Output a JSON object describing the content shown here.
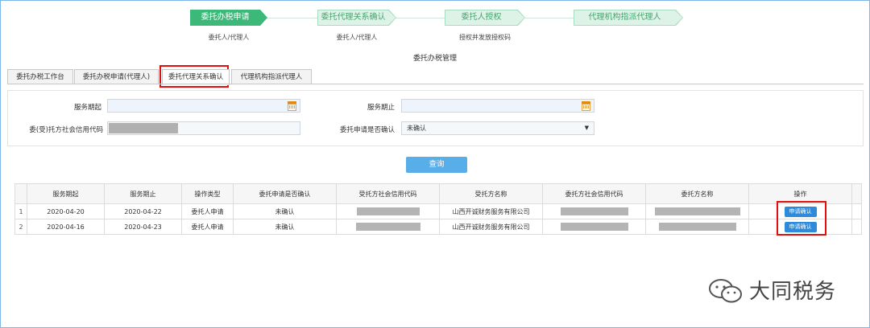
{
  "steps": [
    {
      "label": "委托办税申请",
      "sub": "委托人/代理人",
      "state": "active"
    },
    {
      "label": "委托代理关系确认",
      "sub": "委托人/代理人",
      "state": "inactive"
    },
    {
      "label": "委托人授权",
      "sub": "授权并发放授权码",
      "state": "inactive"
    },
    {
      "label": "代理机构指派代理人",
      "sub": "",
      "state": "inactive"
    }
  ],
  "page_title": "委托办税管理",
  "tabs": [
    {
      "label": "委托办税工作台",
      "active": false
    },
    {
      "label": "委托办税申请(代理人)",
      "active": false
    },
    {
      "label": "委托代理关系确认",
      "active": true
    },
    {
      "label": "代理机构指派代理人",
      "active": false
    }
  ],
  "form": {
    "service_start_label": "服务期起",
    "service_start_value": "",
    "service_end_label": "服务期止",
    "service_end_value": "",
    "credit_code_label": "委(受)托方社会信用代码",
    "confirm_label": "委托申请是否确认",
    "confirm_value": "未确认",
    "icons": {
      "calendar": "calendar-icon",
      "caret": "caret-down-icon"
    }
  },
  "query_button": "查询",
  "table": {
    "headers": [
      "服务期起",
      "服务期止",
      "操作类型",
      "委托申请是否确认",
      "受托方社会信用代码",
      "受托方名称",
      "委托方社会信用代码",
      "委托方名称",
      "操作"
    ],
    "rows": [
      {
        "index": "1",
        "start": "2020-04-20",
        "end": "2020-04-22",
        "op_type": "委托人申请",
        "confirmed": "未确认",
        "trustee_name": "山西开诚财务服务有限公司",
        "action": "申请确认"
      },
      {
        "index": "2",
        "start": "2020-04-16",
        "end": "2020-04-23",
        "op_type": "委托人申请",
        "confirmed": "未确认",
        "trustee_name": "山西开诚财务服务有限公司",
        "action": "申请确认"
      }
    ]
  },
  "watermark": {
    "text": "大同税务",
    "icon": "wechat-icon"
  },
  "colors": {
    "accent_green": "#3cb878",
    "light_green": "#ddf3e7",
    "button_blue": "#58aee9",
    "action_blue": "#2e8bdc",
    "highlight_red": "#e10f0f"
  }
}
